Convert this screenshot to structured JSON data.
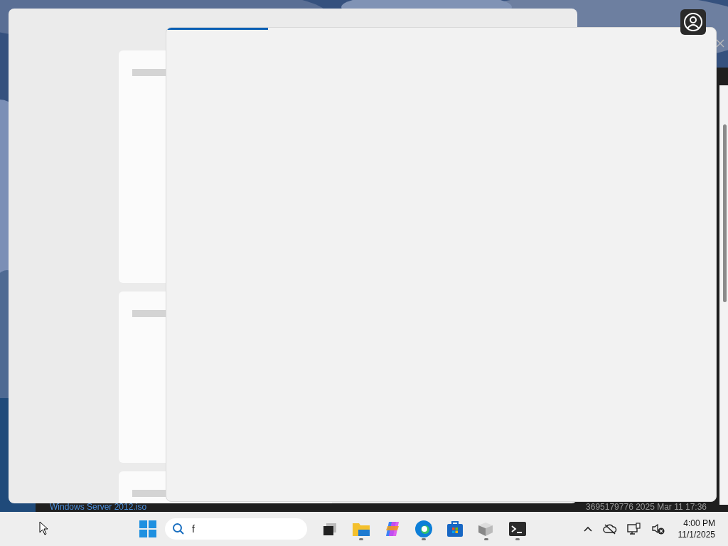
{
  "background_window": {
    "file_name": "Windows Server 2012.iso",
    "file_details": "3695179776 2025 Mar 11 17:36"
  },
  "settings_window": {
    "cards": [
      {
        "kind": "placeholder"
      },
      {
        "kind": "placeholder"
      },
      {
        "kind": "placeholder"
      }
    ]
  },
  "loading_window": {
    "progress": {
      "level": 0.185
    }
  },
  "taskbar": {
    "search": {
      "value": "f"
    },
    "apps": [
      {
        "kind": "task-view",
        "running": false
      },
      {
        "kind": "folder",
        "running": true
      },
      {
        "kind": "copilot",
        "running": false
      },
      {
        "kind": "edge",
        "running": true
      },
      {
        "kind": "store",
        "running": false
      },
      {
        "kind": "boxes",
        "running": true
      },
      {
        "kind": "terminal",
        "running": true
      }
    ],
    "time": "4:00 PM",
    "date": "11/1/2025"
  }
}
